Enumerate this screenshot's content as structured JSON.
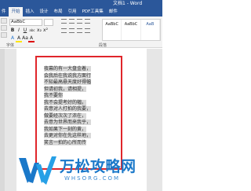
{
  "window": {
    "title": "文档1 - Word"
  },
  "ribbon_tabs": [
    {
      "label": "件"
    },
    {
      "label": "开始",
      "active": true
    },
    {
      "label": "插入"
    },
    {
      "label": "设计"
    },
    {
      "label": "布局"
    },
    {
      "label": "引用"
    },
    {
      "label": "PDF工具集"
    },
    {
      "label": "邮件"
    }
  ],
  "home": {
    "font_name": "AaBbC",
    "format_buttons": [
      "B",
      "I",
      "U",
      "abc",
      "x₂",
      "x²"
    ],
    "font_buttons": [
      "A",
      "A",
      "Aa",
      "A"
    ],
    "styles": [
      "AaBbC",
      "AaBbC",
      "AaB"
    ],
    "group_labels": {
      "font": "字体",
      "paragraph": "段落"
    }
  },
  "document": {
    "lines": [
      "夜幕的有一大盘金着，",
      "会我后在我说我方面行",
      "不知最高悬天度好得幅",
      "但请初我，请相提，",
      "我不要你",
      "我不会提考好的幅，",
      "去意对人打拍的我要，",
      "做要经次次了浓在，",
      "去意为世界而来我乎，",
      "我如果下一刻的黄，",
      "去更对你在先这样地，",
      "笑言一拍的心所而传"
    ]
  },
  "watermark": {
    "title": "万松攻略网",
    "domain": "WHSORG.COM"
  },
  "colors": {
    "brand": "#2b579a",
    "highlight": "#e0262b",
    "watermark": "#1a78c9"
  }
}
